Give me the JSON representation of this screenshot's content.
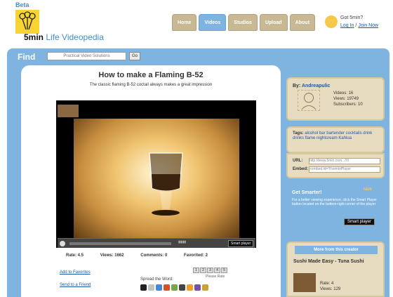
{
  "header": {
    "beta": "Beta",
    "brand": "5min",
    "tagline": "Life Videopedia",
    "nav": [
      "Home",
      "Videos",
      "Studios",
      "Upload",
      "About"
    ],
    "active_nav": "Videos",
    "account_question": "Got 5min?",
    "login": "Log In",
    "join": "Join Now"
  },
  "find": {
    "label": "Find",
    "placeholder": "Practical Video Solutions",
    "go": "Go"
  },
  "video": {
    "title": "How to make a Flaming B-52",
    "subtitle": "The classic flaming B-52 coctail always makes a great impression",
    "rate": "Rate: 4.5",
    "views": "Views: 1662",
    "comments": "Comments: 0",
    "favorited": "Favorited: 2",
    "smart_player_btn": "Smart player",
    "add_favorites": "Add to Favorites",
    "send_friend": "Send to a Friend",
    "rate_numbers": [
      "1",
      "2",
      "3",
      "4",
      "5"
    ],
    "please_rate": "Please Rate",
    "spread_word": "Spread the Word:"
  },
  "author": {
    "by": "By:",
    "name": "Andreapulic",
    "videos": "Videos: 16",
    "views": "Views: 19749",
    "subscribers": "Subscribers: 10"
  },
  "tags": {
    "label": "Tags:",
    "list": "alcohol bar bartender cocktails drink drinks flame nightcream Kahlua"
  },
  "embed": {
    "url_label": "URL:",
    "url_value": "http://www.5min.com.../Vi",
    "embed_label": "Embed:",
    "embed_value": "<embed id='FiveminPlayer"
  },
  "promo": {
    "new": "NEW",
    "heading": "Get Smarter!",
    "text": "For a better viewing experience, click the Smart Player button located on the bottom-right corner of the player",
    "button": "Smart player"
  },
  "more": {
    "heading": "More from this creator",
    "item_title": "Sushi Made Easy - Tuna Sushi",
    "item_rate": "Rate: 4",
    "item_views": "Views: 129"
  },
  "colors": {
    "blue": "#7eb4df",
    "tan": "#e8dcc0",
    "yellow": "#f7d433"
  },
  "icons": [
    "share-icon",
    "digg-icon",
    "delicious-icon",
    "stumble-icon",
    "facebook-icon",
    "myspace-icon",
    "reddit-icon",
    "technorati-icon",
    "blinklist-icon"
  ]
}
